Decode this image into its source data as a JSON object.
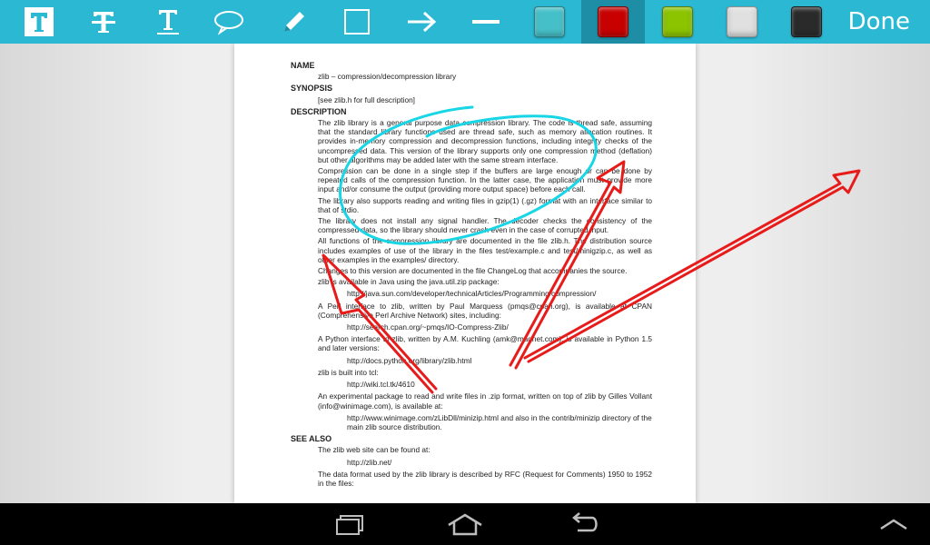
{
  "toolbar": {
    "tools": [
      "text-bold-icon",
      "strikethrough-icon",
      "underline-icon",
      "speech-bubble-icon",
      "pencil-icon",
      "rectangle-icon",
      "arrow-icon",
      "line-icon"
    ],
    "swatches": [
      "#46c0c8",
      "#c80000",
      "#8cc400",
      "#e0e0e0",
      "#2a2a2a"
    ],
    "selected_color": "#c80000",
    "done_label": "Done"
  },
  "doc": {
    "name_heading": "NAME",
    "name_text": "zlib – compression/decompression library",
    "synopsis_heading": "SYNOPSIS",
    "synopsis_text": "[see zlib.h for full description]",
    "description_heading": "DESCRIPTION",
    "p1": "The zlib library is a general purpose data compression library. The code is thread safe, assuming that the standard library functions used are thread safe, such as memory allocation routines. It provides in-memory compression and decompression functions, including integrity checks of the uncompressed data. This version of the library supports only one compression method (deflation) but other algorithms may be added later with the same stream interface.",
    "p2": "Compression can be done in a single step if the buffers are large enough or can be done by repeated calls of the compression function. In the latter case, the application must provide more input and/or consume the output (providing more output space) before each call.",
    "p3": "The library also supports reading and writing files in gzip(1) (.gz) format with an interface similar to that of stdio.",
    "p4": "The library does not install any signal handler. The decoder checks the consistency of the compressed data, so the library should never crash even in the case of corrupted input.",
    "p5": "All functions of the compression library are documented in the file zlib.h. The distribution source includes examples of use of the library in the files test/example.c and test/minigzip.c, as well as other examples in the examples/ directory.",
    "p6": "Changes to this version are documented in the file ChangeLog that accompanies the source.",
    "p7": "zlib is available in Java using the java.util.zip package:",
    "url1": "http://java.sun.com/developer/technicalArticles/Programming/compression/",
    "p8": "A Perl interface to zlib, written by Paul Marquess (pmqs@cpan.org), is available at CPAN (Comprehensive Perl Archive Network) sites, including:",
    "url2": "http://search.cpan.org/~pmqs/IO-Compress-Zlib/",
    "p9": "A Python interface to zlib, written by A.M. Kuchling (amk@magnet.com), is available in Python 1.5 and later versions:",
    "url3": "http://docs.python.org/library/zlib.html",
    "p10": "zlib is built into tcl:",
    "url4": "http://wiki.tcl.tk/4610",
    "p11": "An experimental package to read and write files in .zip format, written on top of zlib by Gilles Vollant (info@winimage.com), is available at:",
    "url5": "http://www.winimage.com/zLibDll/minizip.html and also in the contrib/minizip directory of the main zlib source distribution.",
    "seealso_heading": "SEE ALSO",
    "p12": "The zlib web site can be found at:",
    "url6": "http://zlib.net/",
    "p13": "The data format used by the zlib library is described by RFC (Request for Comments) 1950 to 1952 in the files:"
  },
  "annotations": {
    "ellipse_color": "#19d6e6",
    "arrow_color": "#e81b1b"
  },
  "navbar": {
    "buttons": [
      "recent-apps-icon",
      "home-icon",
      "back-icon",
      "menu-up-icon"
    ]
  }
}
